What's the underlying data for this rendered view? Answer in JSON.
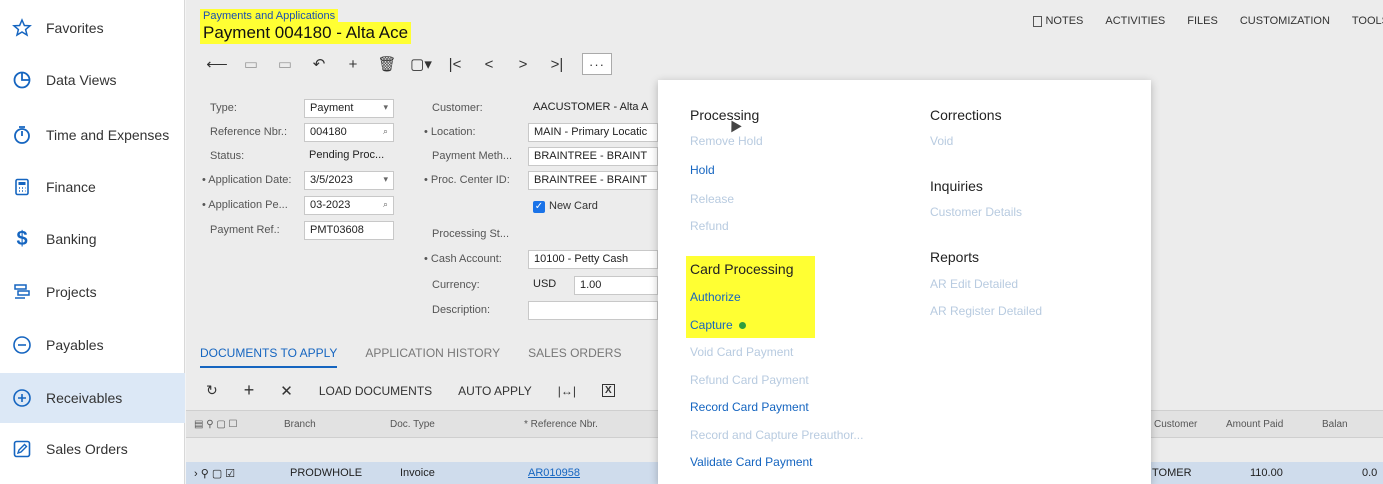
{
  "sidebar": {
    "items": [
      {
        "label": "Favorites",
        "icon": "star-icon"
      },
      {
        "label": "Data Views",
        "icon": "data-views-icon"
      },
      {
        "label": "Time and Expenses",
        "icon": "timer-icon"
      },
      {
        "label": "Finance",
        "icon": "calculator-icon"
      },
      {
        "label": "Banking",
        "icon": "dollar-icon"
      },
      {
        "label": "Projects",
        "icon": "projects-icon"
      },
      {
        "label": "Payables",
        "icon": "minus-circle-icon"
      },
      {
        "label": "Receivables",
        "icon": "plus-circle-icon",
        "active": true
      },
      {
        "label": "Sales Orders",
        "icon": "edit-icon"
      }
    ]
  },
  "header": {
    "breadcrumb": "Payments and Applications",
    "title": "Payment 004180 - Alta Ace",
    "links": [
      "NOTES",
      "ACTIVITIES",
      "FILES",
      "CUSTOMIZATION",
      "TOOLS"
    ]
  },
  "form": {
    "type_label": "Type:",
    "type_value": "Payment",
    "refnbr_label": "Reference Nbr.:",
    "refnbr_value": "004180",
    "status_label": "Status:",
    "status_value": "Pending Proc...",
    "appdate_label": "• Application Date:",
    "appdate_value": "3/5/2023",
    "appperiod_label": "• Application Pe...",
    "appperiod_value": "03-2023",
    "payref_label": "Payment Ref.:",
    "payref_value": "PMT03608",
    "customer_label": "Customer:",
    "customer_value": "AACUSTOMER - Alta A",
    "location_label": "• Location:",
    "location_value": "MAIN - Primary Locatic",
    "paymeth_label": "Payment Meth...",
    "paymeth_value": "BRAINTREE - BRAINT",
    "proccenter_label": "• Proc. Center ID:",
    "proccenter_value": "BRAINTREE - BRAINT",
    "newcard_label": "New Card",
    "procstatus_label": "Processing St...",
    "cashacct_label": "• Cash Account:",
    "cashacct_value": "10100 - Petty Cash",
    "currency_label": "Currency:",
    "currency_value": "USD",
    "rate_value": "1.00",
    "description_label": "Description:"
  },
  "tabs": [
    "DOCUMENTS TO APPLY",
    "APPLICATION HISTORY",
    "SALES ORDERS"
  ],
  "grid": {
    "toolbar": {
      "load": "LOAD DOCUMENTS",
      "auto": "AUTO APPLY"
    },
    "headers": {
      "branch": "Branch",
      "doctype": "Doc. Type",
      "refnbr": "* Reference Nbr.",
      "customer": "Customer",
      "amountpaid": "Amount Paid",
      "balance": "Balan"
    },
    "row": {
      "branch": "PRODWHOLE",
      "doctype": "Invoice",
      "refnbr": "AR010958",
      "customer": "TOMER",
      "amountpaid": "110.00",
      "balance": "0.0"
    }
  },
  "menu": {
    "processing": {
      "title": "Processing",
      "items": [
        {
          "label": "Remove Hold",
          "enabled": false
        },
        {
          "label": "Hold",
          "enabled": true
        },
        {
          "label": "Release",
          "enabled": false
        },
        {
          "label": "Refund",
          "enabled": false
        }
      ]
    },
    "card_processing": {
      "title": "Card Processing",
      "items": [
        {
          "label": "Authorize",
          "enabled": true
        },
        {
          "label": "Capture",
          "enabled": true
        },
        {
          "label": "Void Card Payment",
          "enabled": false
        },
        {
          "label": "Refund Card Payment",
          "enabled": false
        },
        {
          "label": "Record Card Payment",
          "enabled": true
        },
        {
          "label": "Record and Capture Preauthor...",
          "enabled": false
        },
        {
          "label": "Validate Card Payment",
          "enabled": true
        }
      ]
    },
    "corrections": {
      "title": "Corrections",
      "items": [
        {
          "label": "Void",
          "enabled": false
        }
      ]
    },
    "inquiries": {
      "title": "Inquiries",
      "items": [
        {
          "label": "Customer Details",
          "enabled": false
        }
      ]
    },
    "reports": {
      "title": "Reports",
      "items": [
        {
          "label": "AR Edit Detailed",
          "enabled": false
        },
        {
          "label": "AR Register Detailed",
          "enabled": false
        }
      ]
    }
  },
  "colors": {
    "highlight": "#ffff33",
    "link": "#1565c0",
    "disabled": "#b8cbe0",
    "active_row": "#cfdcec"
  }
}
